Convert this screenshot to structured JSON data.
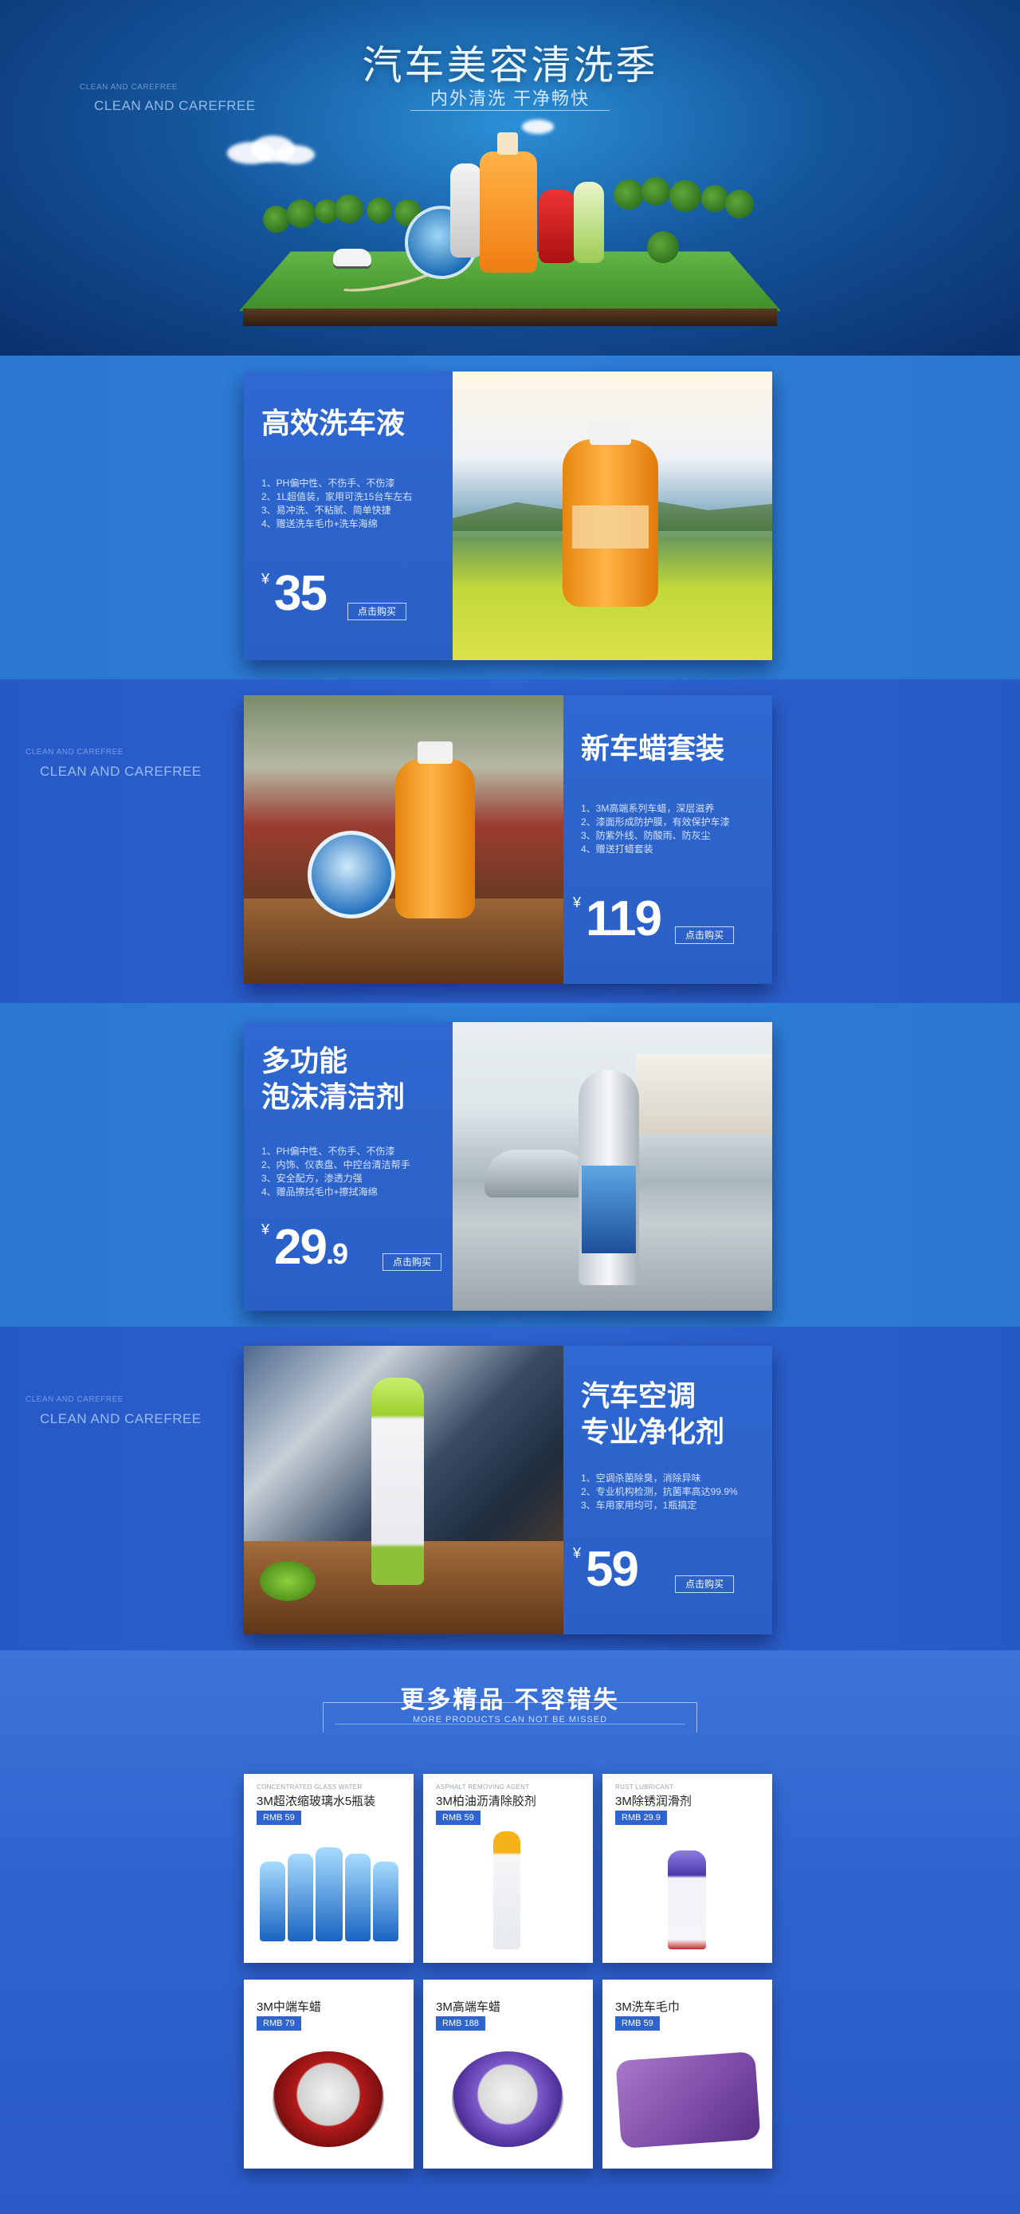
{
  "hero": {
    "title": "汽车美容清洗季",
    "subtitle": "内外清洗 干净畅快",
    "tag_small": "CLEAN AND CAREFREE",
    "tag_big": "CLEAN AND CAREFREE"
  },
  "products": [
    {
      "heading_lines": [
        "高效洗车液"
      ],
      "features": [
        "1、PH偏中性、不伤手、不伤漆",
        "2、1L超值装，家用可洗15台车左右",
        "3、易冲洗、不粘腻、简单快捷",
        "4、赠送洗车毛巾+洗车海绵"
      ],
      "currency": "¥",
      "price": "35",
      "buy_label": "点击购买"
    },
    {
      "heading_lines": [
        "新车蜡套装"
      ],
      "features": [
        "1、3M高端系列车蜡，深层滋养",
        "2、漆面形成防护膜，有效保护车漆",
        "3、防紫外线、防酸雨、防灰尘",
        "4、赠送打蜡套装"
      ],
      "currency": "¥",
      "price": "119",
      "buy_label": "点击购买",
      "tag_small": "CLEAN AND CAREFREE",
      "tag_big": "CLEAN AND CAREFREE"
    },
    {
      "heading_lines": [
        "多功能",
        "泡沫清洁剂"
      ],
      "features": [
        "1、PH偏中性、不伤手、不伤漆",
        "2、内饰、仪表盘、中控台清洁帮手",
        "3、安全配方，渗透力强",
        "4、赠品擦拭毛巾+擦拭海绵"
      ],
      "currency": "¥",
      "price": "29",
      "price_decimal": ".9",
      "buy_label": "点击购买"
    },
    {
      "heading_lines": [
        "汽车空调",
        "专业净化剂"
      ],
      "features": [
        "1、空调杀菌除臭，消除异味",
        "2、专业机构检测，抗菌率高达99.9%",
        "3、车用家用均可，1瓶搞定"
      ],
      "currency": "¥",
      "price": "59",
      "buy_label": "点击购买",
      "tag_small": "CLEAN AND CAREFREE",
      "tag_big": "CLEAN AND CAREFREE"
    }
  ],
  "more": {
    "title": "更多精品 不容错失",
    "subtitle": "MORE PRODUCTS CAN NOT BE MISSED",
    "items": [
      {
        "tag_en": "CONCENTRATED GLASS WATER",
        "name": "3M超浓缩玻璃水5瓶装",
        "price": "RMB 59"
      },
      {
        "tag_en": "ASPHALT REMOVING AGENT",
        "name": "3M柏油沥清除胶剂",
        "price": "RMB 59"
      },
      {
        "tag_en": "RUST LUBRICANT",
        "name": "3M除锈润滑剂",
        "price": "RMB 29.9"
      },
      {
        "tag_en": "",
        "name": "3M中端车蜡",
        "price": "RMB 79"
      },
      {
        "tag_en": "",
        "name": "3M高端车蜡",
        "price": "RMB 188"
      },
      {
        "tag_en": "",
        "name": "3M洗车毛巾",
        "price": "RMB 59"
      }
    ]
  },
  "colors": {
    "accent_blue": "#2e63d0",
    "hero_dark": "#0a2f6c"
  }
}
